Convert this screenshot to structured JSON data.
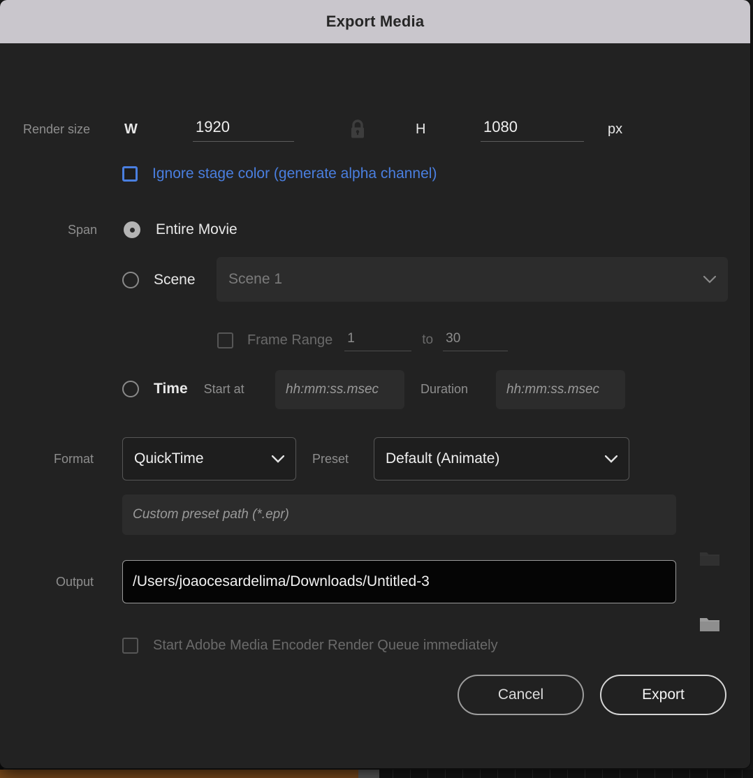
{
  "dialog": {
    "title": "Export Media"
  },
  "render_size": {
    "label": "Render size",
    "width_label": "W",
    "width_value": "1920",
    "lock_icon": "lock-closed-icon",
    "height_label": "H",
    "height_value": "1080",
    "unit": "px"
  },
  "alpha": {
    "label": "Ignore stage color (generate alpha channel)",
    "checked": false,
    "accent_color": "#4a7fe0"
  },
  "span": {
    "label": "Span",
    "options": [
      {
        "id": "entire-movie",
        "label": "Entire Movie",
        "selected": true
      },
      {
        "id": "scene",
        "label": "Scene",
        "selected": false
      },
      {
        "id": "time",
        "label": "Time",
        "selected": false
      }
    ],
    "scene_select": {
      "value": "Scene 1",
      "enabled": false
    },
    "frame_range": {
      "label": "Frame Range",
      "checked": false,
      "from_value": "1",
      "to_label": "to",
      "to_value": "30"
    },
    "time": {
      "start_label": "Start at",
      "start_placeholder": "hh:mm:ss.msec",
      "duration_label": "Duration",
      "duration_placeholder": "hh:mm:ss.msec"
    }
  },
  "format": {
    "label": "Format",
    "value": "QuickTime"
  },
  "preset": {
    "label": "Preset",
    "value": "Default (Animate)",
    "custom_path_placeholder": "Custom preset path (*.epr)",
    "browse_icon": "folder-icon"
  },
  "output": {
    "label": "Output",
    "value": "/Users/joaocesardelima/Downloads/Untitled-3",
    "browse_icon": "folder-icon"
  },
  "media_encoder": {
    "label": "Start Adobe Media Encoder Render Queue immediately",
    "checked": false
  },
  "buttons": {
    "cancel": "Cancel",
    "export": "Export"
  }
}
